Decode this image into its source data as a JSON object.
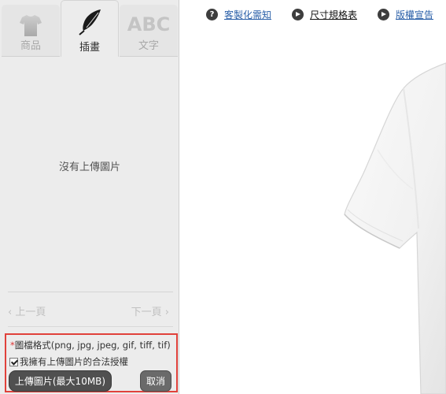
{
  "tabs": [
    {
      "label": "商品",
      "icon": "shirt-icon",
      "active": false
    },
    {
      "label": "插畫",
      "icon": "feather-icon",
      "active": true
    },
    {
      "label": "文字",
      "icon": "abc-icon",
      "icon_text": "ABC",
      "active": false
    }
  ],
  "content": {
    "empty_message": "沒有上傳圖片"
  },
  "pager": {
    "prev_label": "‹ 上一頁",
    "next_label": "下一頁 ›"
  },
  "upload": {
    "required_mark": "*",
    "formats_text": "圖檔格式(png, jpg, jpeg, gif, tiff, tif)",
    "rights_text": "我擁有上傳圖片的合法授權",
    "rights_checked": true,
    "upload_button": "上傳圖片(最大10MB)",
    "cancel_button": "取消"
  },
  "toplinks": [
    {
      "label": "客製化需知",
      "icon": "question-icon",
      "icon_text": "?"
    },
    {
      "label": "尺寸規格表",
      "icon": "play-icon"
    },
    {
      "label": "版權宣告",
      "icon": "play-icon"
    }
  ],
  "colors": {
    "accent_border": "#e0413b",
    "link_blue": "#2a5fa8",
    "button_dark": "#505050"
  }
}
